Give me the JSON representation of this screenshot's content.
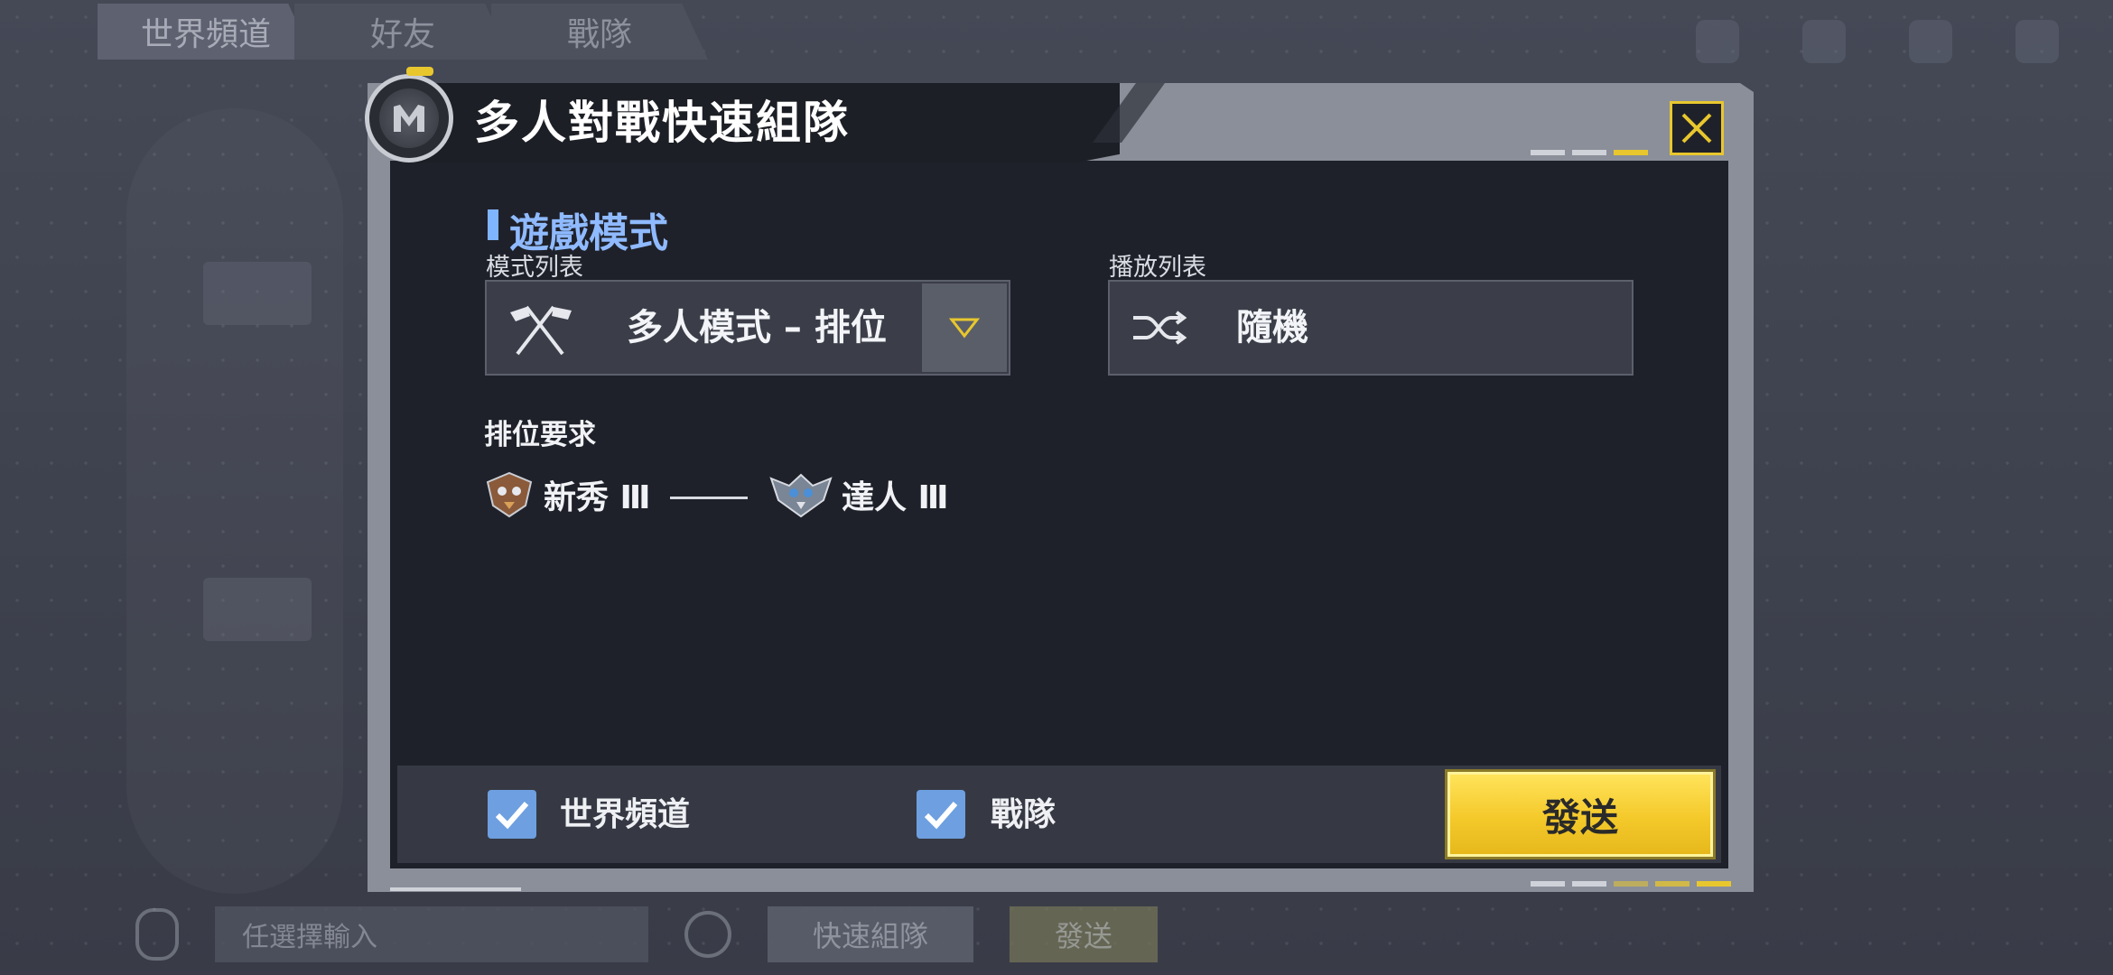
{
  "background": {
    "tabs": [
      "世界頻道",
      "好友",
      "戰隊"
    ],
    "input_placeholder": "任選擇輸入",
    "quick_team_label": "快速組隊",
    "send_label": "發送"
  },
  "dialog": {
    "title": "多人對戰快速組隊",
    "section_title": "遊戲模式",
    "mode_list_label": "模式列表",
    "mode_value": "多人模式 – 排位",
    "playlist_label": "播放列表",
    "playlist_value": "隨機",
    "rank_req_label": "排位要求",
    "rank_min": "新秀 Ⅲ",
    "rank_max": "達人 Ⅲ",
    "options": [
      {
        "label": "世界頻道",
        "checked": true
      },
      {
        "label": "戰隊",
        "checked": true
      }
    ],
    "send_button": "發送"
  },
  "colors": {
    "accent_yellow": "#e8c72e",
    "section_blue": "#8fbaff",
    "checkbox_blue": "#6e9fe0",
    "panel_dark": "#1f212a"
  },
  "icons": {
    "logo": "m-emblem-icon",
    "close": "close-icon",
    "mode": "crossed-flags-icon",
    "dropdown": "triangle-down-icon",
    "playlist": "shuffle-icon",
    "rank_min": "rookie-rank-icon",
    "rank_max": "expert-rank-icon",
    "check": "checkmark-icon"
  }
}
